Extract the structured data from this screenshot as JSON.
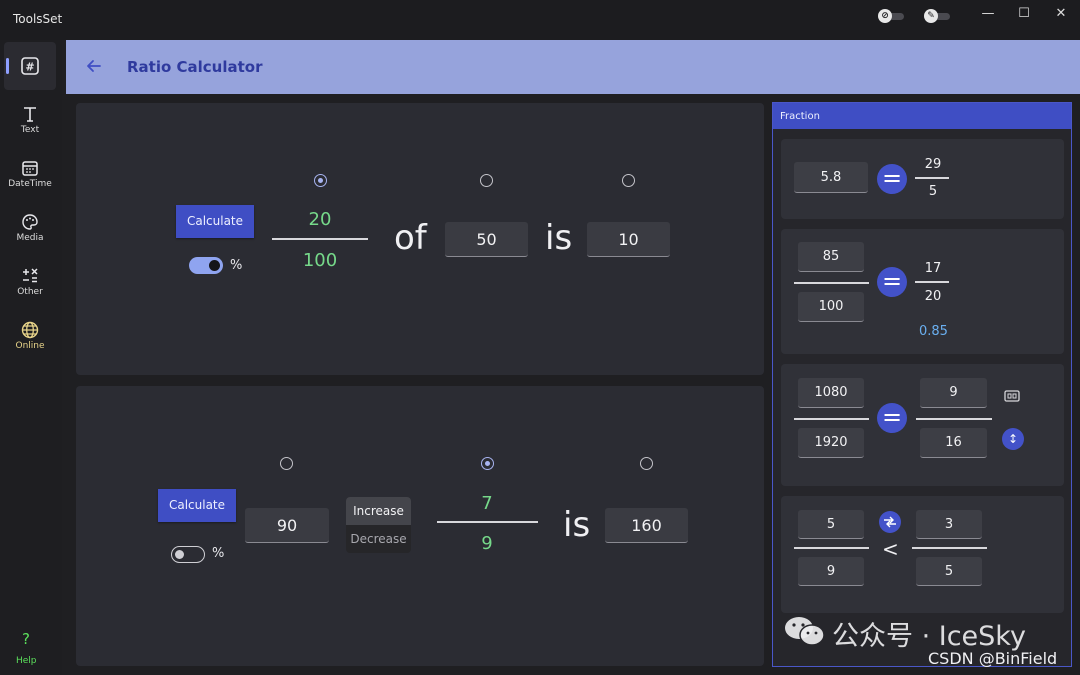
{
  "app": {
    "title": "ToolsSet"
  },
  "window_controls": {
    "minimize": "—",
    "maximize": "☐",
    "close": "✕"
  },
  "titlebar_toggles": [
    "shield-off-icon",
    "pin-icon"
  ],
  "sidebar": {
    "items": [
      {
        "label": "",
        "icon": "hash-icon",
        "active": true
      },
      {
        "label": "Text",
        "icon": "text-icon"
      },
      {
        "label": "DateTime",
        "icon": "calendar-icon"
      },
      {
        "label": "Media",
        "icon": "palette-icon"
      },
      {
        "label": "Other",
        "icon": "other-tools-icon"
      },
      {
        "label": "Online",
        "icon": "globe-icon"
      }
    ],
    "help": {
      "icon": "?",
      "label": "Help"
    }
  },
  "header": {
    "title": "Ratio Calculator",
    "back_icon": "back-arrow-icon"
  },
  "panel1": {
    "calculate": "Calculate",
    "percent_toggle_on": true,
    "percent_label": "%",
    "selected_radio": 0,
    "numerator": "20",
    "denominator": "100",
    "word_of": "of",
    "value_a": "50",
    "word_is": "is",
    "result": "10"
  },
  "panel2": {
    "calculate": "Calculate",
    "percent_toggle_on": false,
    "percent_label": "%",
    "selected_radio": 1,
    "value_a": "90",
    "increase": "Increase",
    "decrease": "Decrease",
    "selected_mode": "Increase",
    "numerator": "7",
    "denominator": "9",
    "word_is": "is",
    "result": "160"
  },
  "fraction": {
    "title": "Fraction",
    "card1": {
      "input": "5.8",
      "equals": "=",
      "num": "29",
      "den": "5"
    },
    "card2": {
      "num_input": "85",
      "den_input": "100",
      "equals": "=",
      "num": "17",
      "den": "20",
      "decimal": "0.85"
    },
    "card3": {
      "num_input": "1080",
      "den_input": "1920",
      "equals": "=",
      "num": "9",
      "den": "16",
      "swap_icon": "↕"
    },
    "card4": {
      "a_num": "5",
      "a_den": "9",
      "compare": "<",
      "b_num": "3",
      "b_den": "5"
    }
  },
  "watermark": {
    "text": "公众号 · IceSky",
    "source": "CSDN @BinField"
  },
  "colors": {
    "accent": "#3f4ec4",
    "header_bg": "#96a3dc",
    "green": "#76d98a",
    "decimal_blue": "#6aaff0"
  }
}
